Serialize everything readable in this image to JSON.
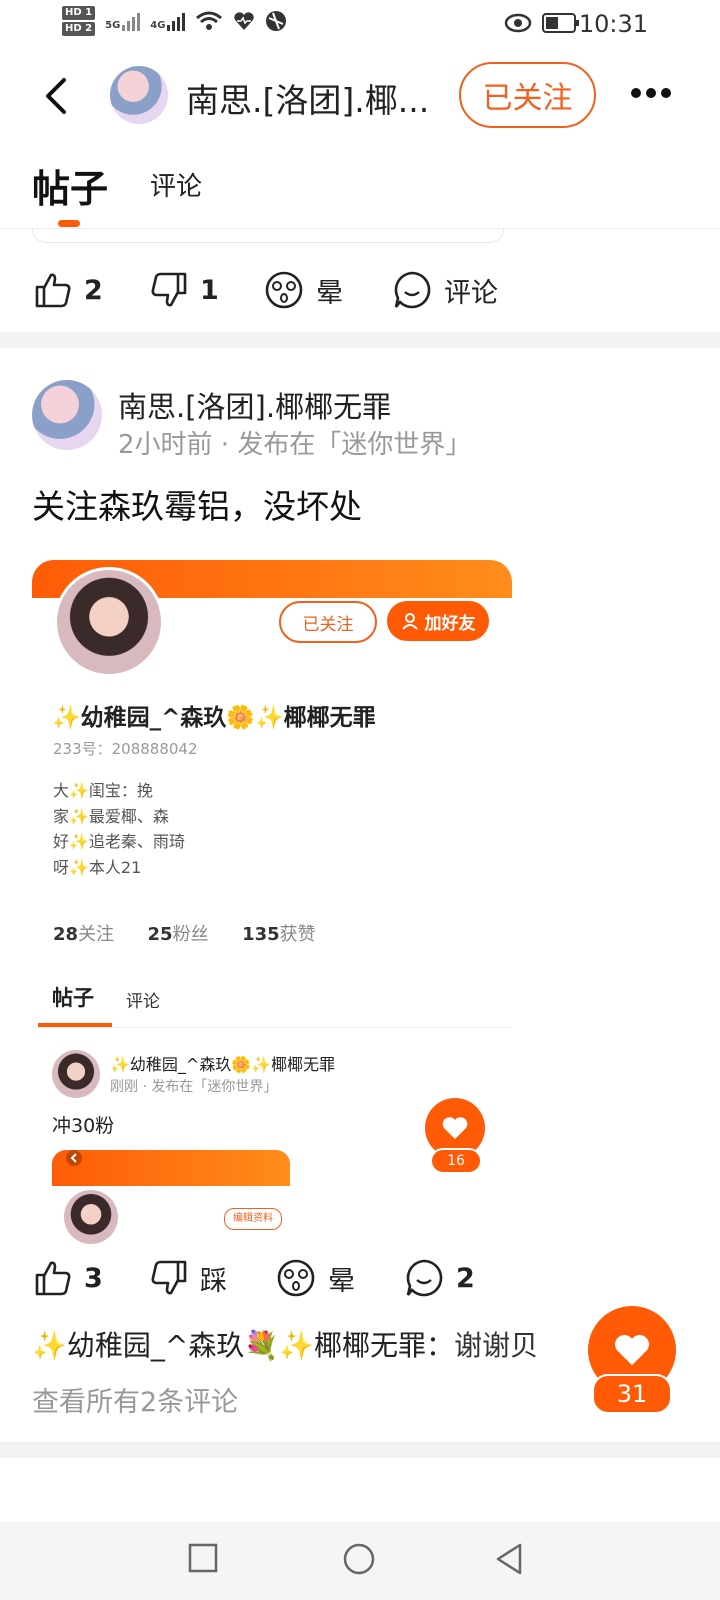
{
  "status_bar": {
    "hd1": "HD 1",
    "hd2": "HD 2",
    "net1": "5G",
    "net2": "4G",
    "time": "10:31"
  },
  "header": {
    "title": "南思.[洛团].椰...",
    "follow_label": "已关注"
  },
  "tabs": {
    "posts": "帖子",
    "comments": "评论"
  },
  "prev_post_actions": {
    "like_count": "2",
    "dislike_count": "1",
    "dizzy_label": "晕",
    "comment_label": "评论"
  },
  "post": {
    "author": "南思.[洛团].椰椰无罪",
    "meta": "2小时前 · 发布在「迷你世界」",
    "text": "关注森玖霉铝，没坏处"
  },
  "card": {
    "followed_label": "已关注",
    "add_friend_label": "加好友",
    "name": "✨幼稚园_^森玖🌼✨椰椰无罪",
    "id_line": "233号：208888042",
    "bio": [
      "大✨闺宝：挽",
      "家✨最爱椰、森",
      "好✨追老秦、雨琦",
      "呀✨本人21"
    ],
    "stats": {
      "following_num": "28",
      "following_label": "关注",
      "fans_num": "25",
      "fans_label": "粉丝",
      "likes_num": "135",
      "likes_label": "获赞"
    },
    "tab_posts": "帖子",
    "tab_comments": "评论",
    "inner_post": {
      "author": "✨幼稚园_^森玖🌼✨椰椰无罪",
      "meta": "刚刚 · 发布在「迷你世界」",
      "text": "冲30粉",
      "like_count": "16",
      "edit_label": "编辑资料"
    }
  },
  "post_actions": {
    "like_count": "3",
    "dislike_label": "踩",
    "dizzy_label": "晕",
    "comment_count": "2"
  },
  "comment_preview": {
    "author": "✨幼稚园_^森玖💐✨椰椰无罪：",
    "text": "谢谢贝",
    "view_all": "查看所有2条评论"
  },
  "floating_like": {
    "count": "31"
  },
  "colors": {
    "accent": "#ff5a06",
    "text_gray": "#888888"
  }
}
